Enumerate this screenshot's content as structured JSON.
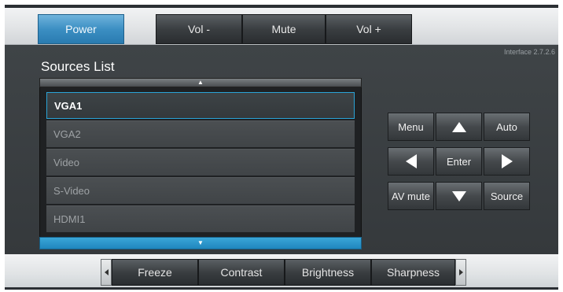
{
  "top_bar": {
    "power_label": "Power",
    "vol_minus_label": "Vol -",
    "mute_label": "Mute",
    "vol_plus_label": "Vol +"
  },
  "interface_version": "Interface 2.7.2.6",
  "sources": {
    "title": "Sources List",
    "items": [
      "VGA1",
      "VGA2",
      "Video",
      "S-Video",
      "HDMI1"
    ],
    "selected": "VGA1"
  },
  "remote": {
    "menu_label": "Menu",
    "auto_label": "Auto",
    "enter_label": "Enter",
    "av_mute_label": "AV mute",
    "source_label": "Source",
    "up_icon": "up-arrow-icon",
    "down_icon": "down-arrow-icon",
    "left_icon": "left-arrow-icon",
    "right_icon": "right-arrow-icon"
  },
  "bottom_bar": {
    "freeze_label": "Freeze",
    "contrast_label": "Contrast",
    "brightness_label": "Brightness",
    "sharpness_label": "Sharpness"
  },
  "colors": {
    "accent_blue": "#3c8fc3",
    "panel_dark": "#3a3e41",
    "selected_border": "#2aa3d6"
  }
}
